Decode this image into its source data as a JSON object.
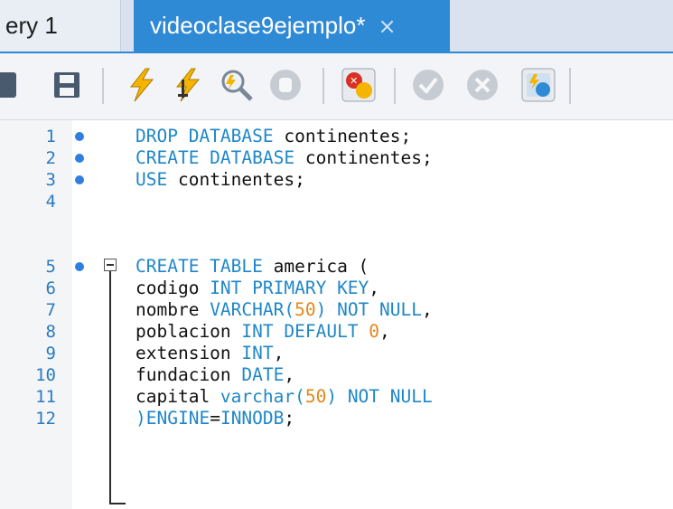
{
  "tabs": [
    {
      "label": "ery 1",
      "active": false
    },
    {
      "label": "videoclase9ejemplo*",
      "active": true,
      "close_glyph": "×"
    }
  ],
  "toolbar": {
    "icons": [
      "new-tab-icon",
      "save-icon",
      "execute-icon",
      "execute-current-icon",
      "explain-icon",
      "stop-icon",
      "stop-on-error-icon",
      "commit-icon",
      "rollback-icon",
      "autocommit-icon"
    ]
  },
  "editor": {
    "lines": [
      {
        "n": "1",
        "modified": true
      },
      {
        "n": "2",
        "modified": true
      },
      {
        "n": "3",
        "modified": true
      },
      {
        "n": "4",
        "modified": false
      },
      {
        "n": "5",
        "modified": true
      },
      {
        "n": "6",
        "modified": false
      },
      {
        "n": "7",
        "modified": false
      },
      {
        "n": "8",
        "modified": false
      },
      {
        "n": "9",
        "modified": false
      },
      {
        "n": "10",
        "modified": false
      },
      {
        "n": "11",
        "modified": false
      },
      {
        "n": "12",
        "modified": false
      }
    ],
    "code": {
      "l1": [
        "DROP DATABASE",
        " continentes;"
      ],
      "l2": [
        "CREATE DATABASE",
        " continentes;"
      ],
      "l3": [
        "USE",
        " continentes;"
      ],
      "l5": [
        "CREATE TABLE",
        " america ("
      ],
      "l6": [
        "codigo ",
        "INT PRIMARY KEY",
        ","
      ],
      "l7": [
        "nombre ",
        "VARCHAR(",
        "50",
        ")",
        " NOT NULL",
        ","
      ],
      "l8": [
        "poblacion ",
        "INT DEFAULT ",
        "0",
        ","
      ],
      "l9": [
        "extension ",
        "INT",
        ","
      ],
      "l10": [
        "fundacion ",
        "DATE",
        ","
      ],
      "l11": [
        "capital ",
        "varchar(",
        "50",
        ")",
        " NOT NULL"
      ],
      "l12": [
        ")",
        "ENGINE",
        "=",
        "INNODB",
        ";"
      ]
    }
  },
  "colors": {
    "keyword": "#1f87c8",
    "number": "#e3871a",
    "line_number": "#2b7bbf",
    "active_tab": "#2f8ad6"
  }
}
